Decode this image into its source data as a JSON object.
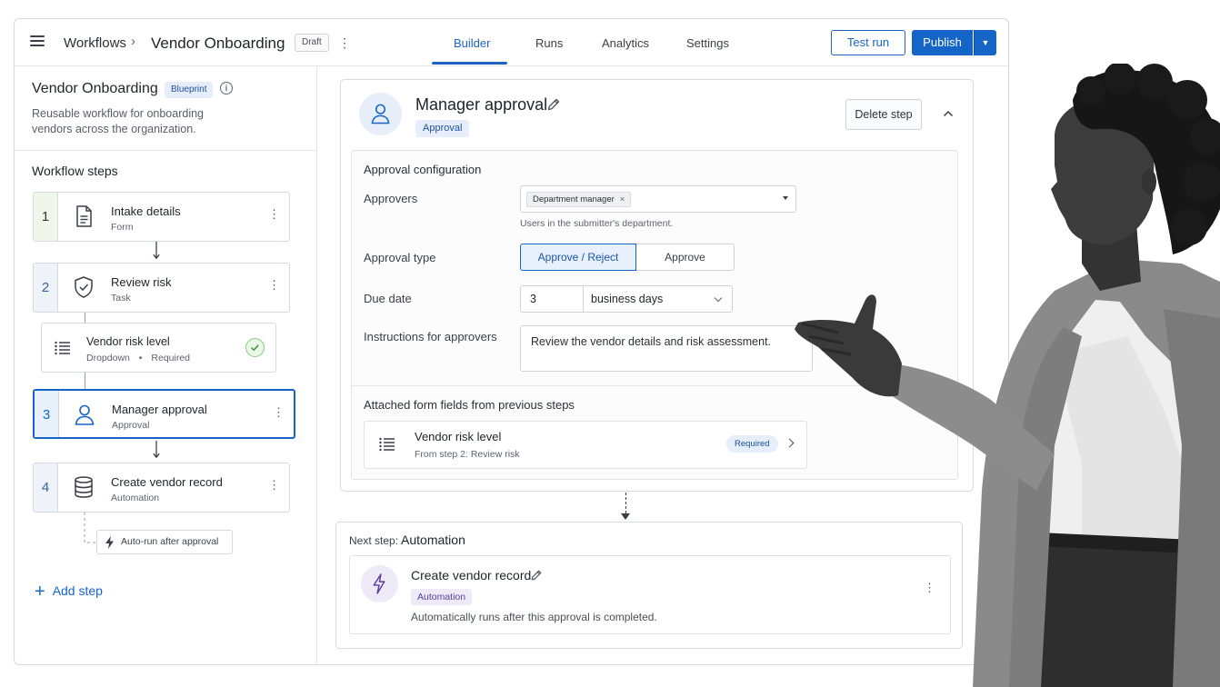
{
  "header": {
    "breadcrumb_root": "Workflows",
    "breadcrumb_separator": "›",
    "breadcrumb_current": "Vendor Onboarding",
    "status_badge": "Draft",
    "tabs": [
      {
        "label": "Builder",
        "active": true
      },
      {
        "label": "Runs",
        "active": false
      },
      {
        "label": "Analytics",
        "active": false
      },
      {
        "label": "Settings",
        "active": false
      }
    ],
    "test_run_label": "Test run",
    "publish_label": "Publish"
  },
  "sidebar": {
    "title": "Vendor Onboarding",
    "badge": "Blueprint",
    "description": "Reusable workflow for onboarding vendors across the organization.",
    "steps_title": "Workflow steps",
    "steps": [
      {
        "number": "1",
        "name": "Intake details",
        "type": "Form",
        "icon": "document-icon"
      },
      {
        "number": "2",
        "name": "Review risk",
        "type": "Task",
        "icon": "shield-check-icon"
      },
      {
        "number": "3",
        "name": "Manager approval",
        "type": "Approval",
        "icon": "user-icon",
        "selected": true
      },
      {
        "number": "4",
        "name": "Create vendor record",
        "type": "Automation",
        "icon": "database-icon"
      }
    ],
    "sub_field": {
      "name": "Vendor risk level",
      "kind": "Dropdown",
      "separator": "•",
      "required": "Required"
    },
    "auto_run": "Auto-run after approval",
    "add_step": "Add step"
  },
  "detail": {
    "title": "Manager approval",
    "type_badge": "Approval",
    "delete_label": "Delete step",
    "config_title": "Approval configuration",
    "approvers_label": "Approvers",
    "approver_chip": "Department manager",
    "approver_chip_remove": "×",
    "approvers_helper": "Users in the submitter's department.",
    "approval_type_label": "Approval type",
    "approval_type_options": [
      "Approve / Reject",
      "Approve"
    ],
    "approval_type_selected": "Approve / Reject",
    "due_date_label": "Due date",
    "due_date_value": "3",
    "due_date_unit": "business days",
    "instructions_label": "Instructions for approvers",
    "instructions_value": "Review the vendor details and risk assessment.",
    "attached_title": "Attached form fields from previous steps",
    "attached_field": {
      "name": "Vendor risk level",
      "from": "From step 2: Review risk",
      "badge": "Required"
    }
  },
  "next_step": {
    "prefix": "Next step:",
    "kind": "Automation",
    "name": "Create vendor record",
    "badge": "Automation",
    "description": "Automatically runs after this approval is completed."
  },
  "colors": {
    "accent": "#1565c8",
    "accent_light": "#e8f0fc",
    "automation_accent": "#5b3f98",
    "border": "#d6d9de"
  }
}
